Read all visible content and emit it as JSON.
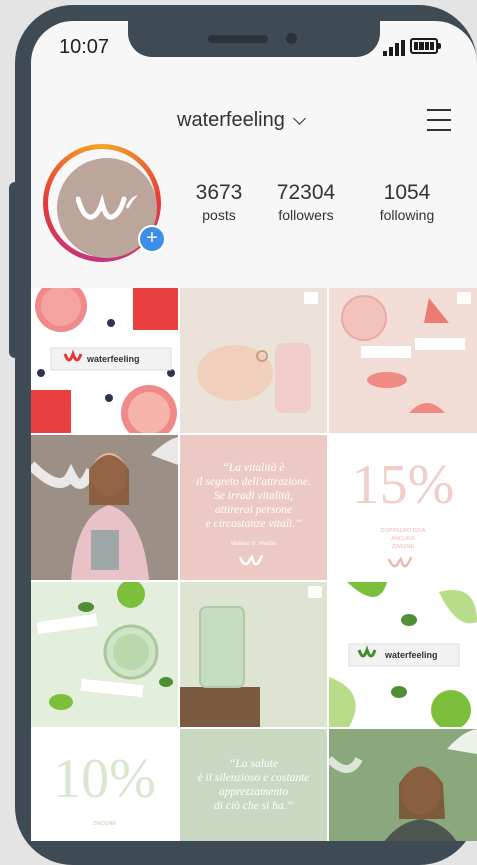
{
  "status_bar": {
    "time": "10:07"
  },
  "profile": {
    "username": "waterfeeling",
    "stats": [
      {
        "value": "3673",
        "label": "posts"
      },
      {
        "value": "72304",
        "label": "followers"
      },
      {
        "value": "1054",
        "label": "following"
      }
    ]
  },
  "posts": {
    "brand_label": "waterfeeling",
    "quote1": {
      "lines": [
        "“La vitalità è",
        "il segreto dell'attrazione.",
        "Se irradi vitalità,",
        "attirerai persone",
        "e circostanze vitali.”"
      ],
      "author": "Wallace D. Wattles"
    },
    "pct1": {
      "value": "15%",
      "caption": [
        "DOPPELRO EDIA",
        "ANGURA",
        "ZINGINE"
      ]
    },
    "pct2": {
      "value": "10%",
      "caption": "ZNCONE"
    },
    "quote2": {
      "lines": [
        "“La salute",
        "è il silenzioso e costante",
        "apprezzamento",
        "di ciò che si ha.”"
      ]
    }
  },
  "colors": {
    "accent_blue": "#3d8ee8",
    "brand_red": "#e5383b",
    "phone_frame": "#3e4b54",
    "avatar_bg": "#bca59a"
  }
}
